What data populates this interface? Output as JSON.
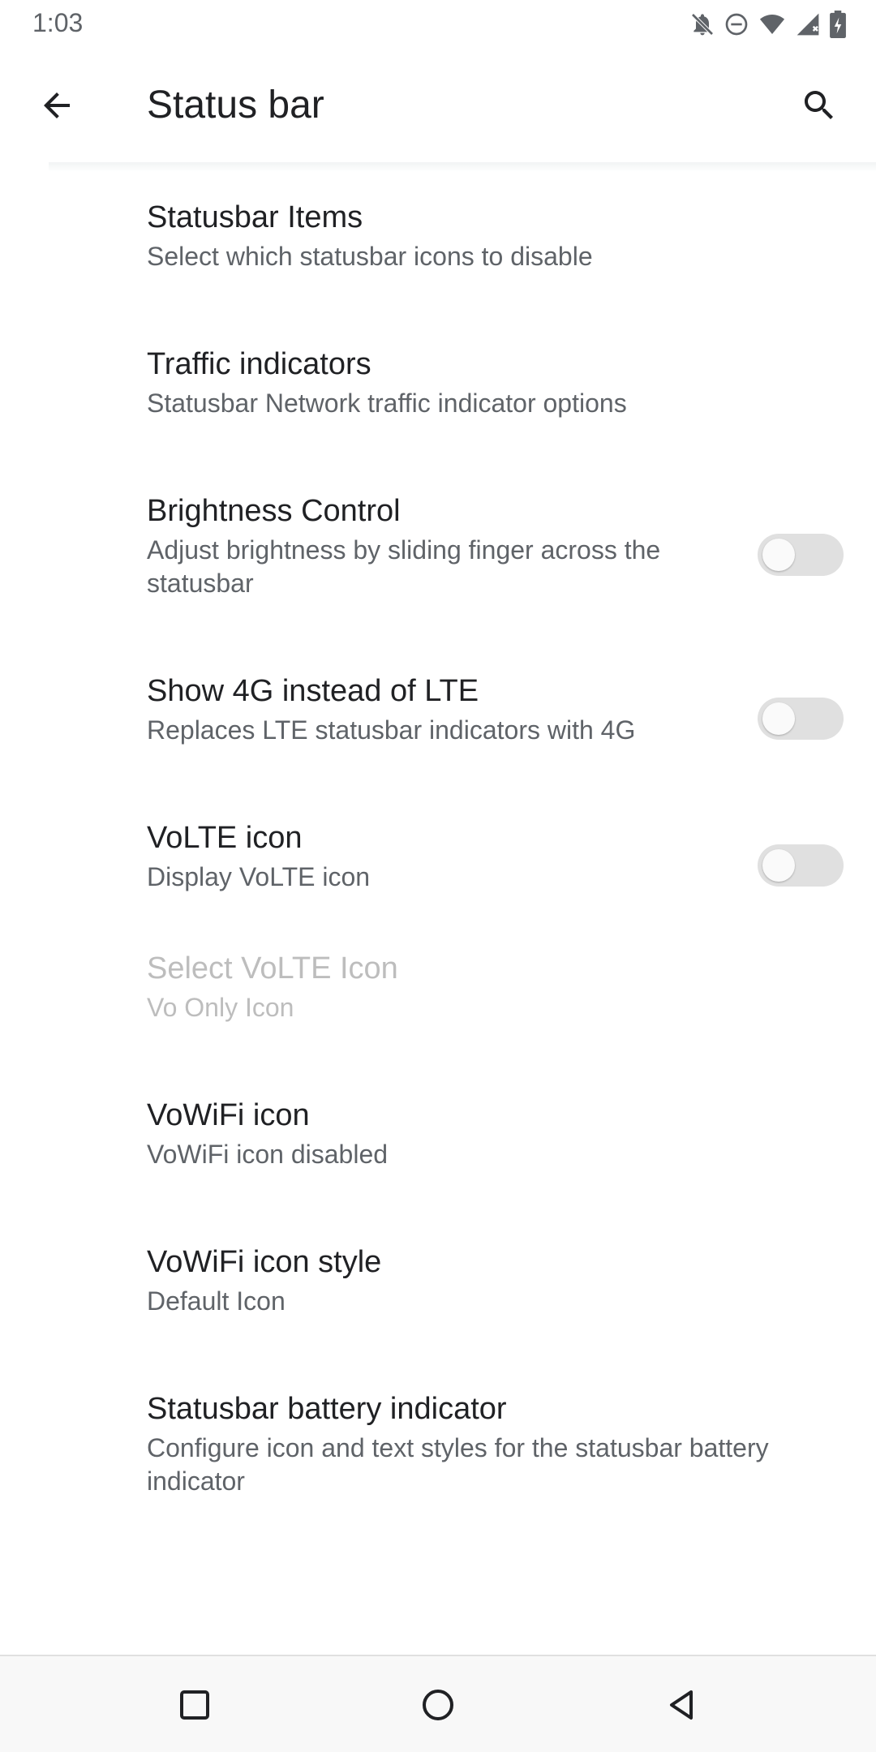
{
  "status_bar": {
    "time": "1:03",
    "icons": [
      "notifications-off-icon",
      "do-not-disturb-icon",
      "wifi-icon",
      "cellular-signal-icon",
      "battery-charging-icon"
    ]
  },
  "toolbar": {
    "title": "Status bar",
    "back_icon": "back-arrow-icon",
    "search_icon": "search-icon"
  },
  "preferences": [
    {
      "title": "Statusbar Items",
      "summary": "Select which statusbar icons to disable",
      "toggle": null,
      "enabled": true
    },
    {
      "title": "Traffic indicators",
      "summary": "Statusbar Network traffic indicator options",
      "toggle": null,
      "enabled": true
    },
    {
      "title": "Brightness Control",
      "summary": "Adjust brightness by sliding finger across the statusbar",
      "toggle": false,
      "enabled": true
    },
    {
      "title": "Show 4G instead of LTE",
      "summary": "Replaces LTE statusbar indicators with 4G",
      "toggle": false,
      "enabled": true
    },
    {
      "title": "VoLTE icon",
      "summary": "Display VoLTE icon",
      "toggle": false,
      "enabled": true
    },
    {
      "title": "Select VoLTE Icon",
      "summary": "Vo Only Icon",
      "toggle": null,
      "enabled": false
    },
    {
      "title": "VoWiFi icon",
      "summary": "VoWiFi icon disabled",
      "toggle": null,
      "enabled": true
    },
    {
      "title": "VoWiFi icon style",
      "summary": "Default Icon",
      "toggle": null,
      "enabled": true
    },
    {
      "title": "Statusbar battery indicator",
      "summary": "Configure icon and text styles for the statusbar battery indicator",
      "toggle": null,
      "enabled": true
    }
  ],
  "nav_bar": {
    "recents_icon": "recents-square-icon",
    "home_icon": "home-circle-icon",
    "back_icon": "back-triangle-icon"
  },
  "colors": {
    "text_primary": "#202124",
    "text_secondary": "#5f6368",
    "text_disabled": "#bdbdbd",
    "toggle_off_track": "#e0e0e0",
    "toggle_off_thumb": "#fafafa"
  }
}
